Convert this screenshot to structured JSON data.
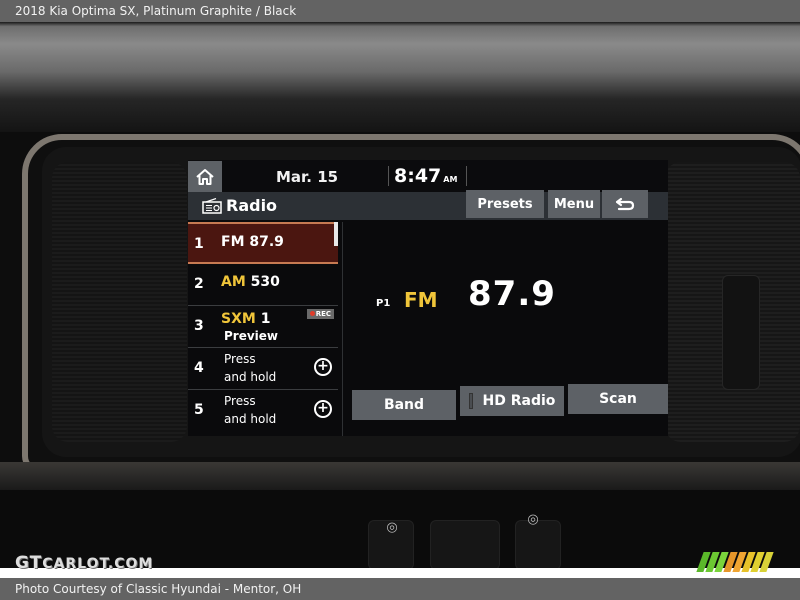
{
  "caption": {
    "top": "2018 Kia Optima SX,  Platinum Graphite / Black",
    "bottom": "Photo Courtesy of Classic Hyundai - Mentor, OH"
  },
  "watermark": {
    "big": "GT",
    "small": "CARLOT.COM"
  },
  "screen": {
    "status": {
      "date": "Mar. 15",
      "time": "8:47",
      "ampm": "AM"
    },
    "header": {
      "title": "Radio",
      "icon": "radio-icon"
    },
    "top_buttons": {
      "presets": "Presets",
      "menu": "Menu",
      "back_icon": "back-arrow-icon"
    },
    "presets": [
      {
        "num": "1",
        "band": "FM",
        "freq": "87.9",
        "active": true
      },
      {
        "num": "2",
        "band": "AM",
        "freq": "530"
      },
      {
        "num": "3",
        "band": "SXM",
        "freq": "1",
        "sub": "Preview",
        "badge": "REC"
      },
      {
        "num": "4",
        "line1": "Press",
        "line2": "and hold",
        "add_icon": "plus-circle-icon"
      },
      {
        "num": "5",
        "line1": "Press",
        "line2": "and hold",
        "add_icon": "plus-circle-icon"
      }
    ],
    "now_playing": {
      "preset": "P1",
      "band": "FM",
      "frequency": "87.9"
    },
    "bottom_buttons": {
      "band": "Band",
      "hd_radio": "HD Radio",
      "scan": "Scan"
    }
  },
  "colors": {
    "accent_yellow": "#f0c53a",
    "active_preset_bg": "#4b1610",
    "active_preset_border": "#c77a52",
    "button_gray": "#5d6166",
    "rec_dot": "#e03c2a"
  }
}
